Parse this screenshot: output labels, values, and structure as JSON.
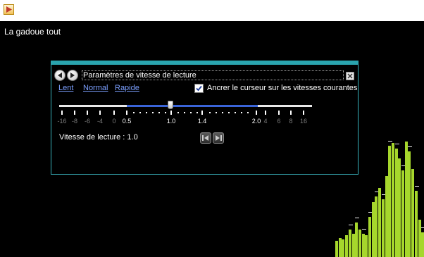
{
  "app": {
    "icon": "play-icon"
  },
  "track": {
    "title": "La gadoue tout"
  },
  "dialog": {
    "title": "Paramètres de vitesse de lecture",
    "nav": {
      "back_icon": "chevron-left-icon",
      "forward_icon": "chevron-right-icon"
    },
    "close_icon": "close-icon",
    "links": {
      "slow": "Lent",
      "normal": "Normal",
      "fast": "Rapide"
    },
    "anchor_checkbox": {
      "label": "Ancrer le curseur sur les vitesses courantes",
      "checked": true
    },
    "slider": {
      "value": 1.0,
      "labels": [
        {
          "text": "-16",
          "main": false
        },
        {
          "text": "-8",
          "main": false
        },
        {
          "text": "-6",
          "main": false
        },
        {
          "text": "-4",
          "main": false
        },
        {
          "text": "0",
          "main": false
        },
        {
          "text": "0.5",
          "main": true
        },
        {
          "text": "1.0",
          "main": true
        },
        {
          "text": "1.4",
          "main": true
        },
        {
          "text": "2.0",
          "main": true
        },
        {
          "text": "4",
          "main": false
        },
        {
          "text": "6",
          "main": false
        },
        {
          "text": "8",
          "main": false
        },
        {
          "text": "16",
          "main": false
        }
      ]
    },
    "speed_readout": "Vitesse de lecture : 1.0",
    "step_buttons": {
      "slower_icon": "step-slower-icon",
      "faster_icon": "step-faster-icon"
    }
  },
  "visualization": {
    "color": "#a6d72c",
    "levels": [
      0.12,
      0.14,
      0.13,
      0.16,
      0.2,
      0.17,
      0.25,
      0.2,
      0.17,
      0.16,
      0.29,
      0.4,
      0.44,
      0.5,
      0.42,
      0.59,
      0.81,
      0.83,
      0.79,
      0.72,
      0.63,
      0.84,
      0.77,
      0.64,
      0.48,
      0.27,
      0.18
    ]
  },
  "colors": {
    "accent": "#2aa4ae",
    "slider_range": "#3a64d8",
    "link": "#7ca0ff"
  }
}
